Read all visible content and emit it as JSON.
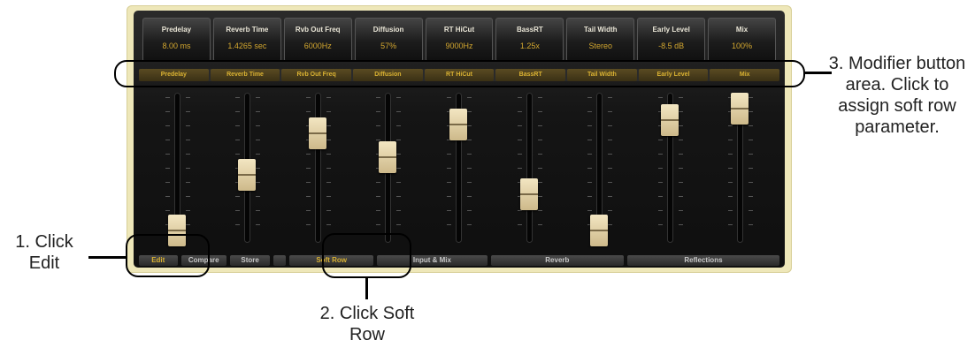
{
  "params": [
    {
      "name": "Predelay",
      "value": "8.00 ms"
    },
    {
      "name": "Reverb Time",
      "value": "1.4265 sec"
    },
    {
      "name": "Rvb Out Freq",
      "value": "6000Hz"
    },
    {
      "name": "Diffusion",
      "value": "57%"
    },
    {
      "name": "RT HiCut",
      "value": "9000Hz"
    },
    {
      "name": "BassRT",
      "value": "1.25x"
    },
    {
      "name": "Tail Width",
      "value": "Stereo"
    },
    {
      "name": "Early Level",
      "value": "-8.5 dB"
    },
    {
      "name": "Mix",
      "value": "100%"
    }
  ],
  "modifiers": [
    "Predelay",
    "Reverb Time",
    "Rvb Out Freq",
    "Diffusion",
    "RT HiCut",
    "BassRT",
    "Tail Width",
    "Early Level",
    "Mix"
  ],
  "fader_levels": [
    0.05,
    0.47,
    0.78,
    0.6,
    0.85,
    0.32,
    0.05,
    0.88,
    0.97
  ],
  "bottom": {
    "edit": "Edit",
    "compare": "Compare",
    "store": "Store",
    "soft_row": "Soft Row",
    "input_mix": "Input & Mix",
    "reverb": "Reverb",
    "reflections": "Reflections"
  },
  "annotations": {
    "click_edit": "1. Click Edit",
    "click_soft_row": "2. Click Soft Row",
    "modifier_area": "3. Modifier button area. Click to assign soft row parameter."
  },
  "colors": {
    "accent": "#d9b132",
    "panel": "#eee7b9",
    "value": "#d3a72f"
  }
}
